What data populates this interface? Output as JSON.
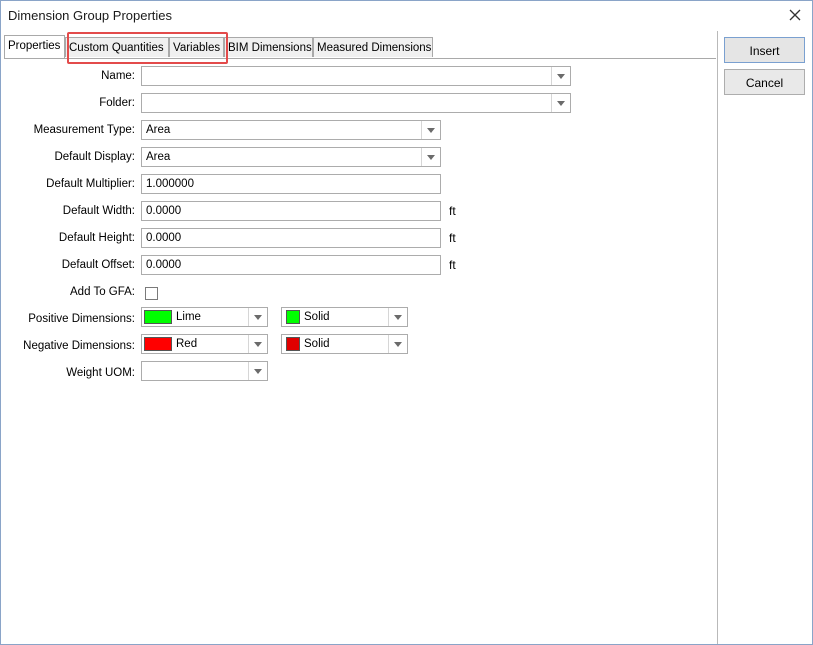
{
  "window": {
    "title": "Dimension Group Properties"
  },
  "tabs": [
    {
      "label": "Properties"
    },
    {
      "label": "Custom Quantities"
    },
    {
      "label": "Variables"
    },
    {
      "label": "BIM Dimensions"
    },
    {
      "label": "Measured Dimensions"
    }
  ],
  "form": {
    "name": {
      "label": "Name:",
      "value": ""
    },
    "folder": {
      "label": "Folder:",
      "value": ""
    },
    "measurement_type": {
      "label": "Measurement Type:",
      "value": "Area"
    },
    "default_display": {
      "label": "Default Display:",
      "value": "Area"
    },
    "default_multiplier": {
      "label": "Default Multiplier:",
      "value": "1.000000"
    },
    "default_width": {
      "label": "Default Width:",
      "value": "0.0000",
      "unit": "ft"
    },
    "default_height": {
      "label": "Default Height:",
      "value": "0.0000",
      "unit": "ft"
    },
    "default_offset": {
      "label": "Default Offset:",
      "value": "0.0000",
      "unit": "ft"
    },
    "add_to_gfa": {
      "label": "Add To GFA:",
      "checked": false
    },
    "positive_dimensions": {
      "label": "Positive Dimensions:",
      "color_name": "Lime",
      "color": "#00ff00",
      "pattern": "Solid",
      "pattern_color": "#00ff00"
    },
    "negative_dimensions": {
      "label": "Negative Dimensions:",
      "color_name": "Red",
      "color": "#ff0000",
      "pattern": "Solid",
      "pattern_color": "#e00000"
    },
    "weight_uom": {
      "label": "Weight UOM:",
      "value": ""
    }
  },
  "buttons": {
    "insert": "Insert",
    "cancel": "Cancel"
  },
  "colors": {
    "highlight": "#e34b4b"
  }
}
